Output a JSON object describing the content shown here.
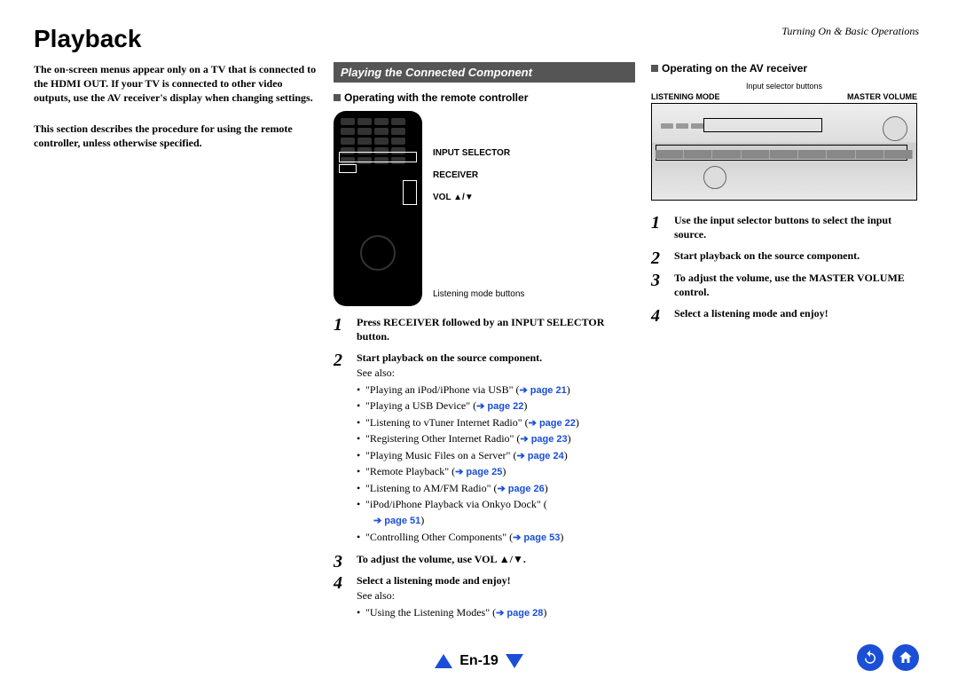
{
  "header": {
    "breadcrumb": "Turning On & Basic Operations"
  },
  "title": "Playback",
  "col1": {
    "note1": "The on-screen menus appear only on a TV that is connected to the HDMI OUT. If your TV is connected to other video outputs, use the AV receiver's display when changing settings.",
    "note2": "This section describes the procedure for using the remote controller, unless otherwise specified."
  },
  "col2": {
    "section": "Playing the Connected Component",
    "sub": "Operating with the remote controller",
    "callouts": {
      "c1": "INPUT SELECTOR",
      "c2": "RECEIVER",
      "c3": "VOL ▲/▼",
      "c4": "Listening mode buttons"
    },
    "steps": [
      {
        "head": "Press RECEIVER followed by an INPUT SELECTOR button."
      },
      {
        "head": "Start playback on the source component.",
        "sub": "See also:",
        "bullets": [
          {
            "t": "\"Playing an iPod/iPhone via USB\" (",
            "link": "page 21",
            "after": ")"
          },
          {
            "t": "\"Playing a USB Device\" (",
            "link": "page 22",
            "after": ")"
          },
          {
            "t": "\"Listening to vTuner Internet Radio\" (",
            "link": "page 22",
            "after": ")"
          },
          {
            "t": "\"Registering Other Internet Radio\" (",
            "link": "page 23",
            "after": ")"
          },
          {
            "t": "\"Playing Music Files on a Server\" (",
            "link": "page 24",
            "after": ")"
          },
          {
            "t": "\"Remote Playback\" (",
            "link": "page 25",
            "after": ")"
          },
          {
            "t": "\"Listening to AM/FM Radio\" (",
            "link": "page 26",
            "after": ")"
          },
          {
            "t": "\"iPod/iPhone Playback via Onkyo Dock\" (",
            "link": "page 51",
            "after": ")",
            "indent": true
          },
          {
            "t": "\"Controlling Other Components\" (",
            "link": "page 53",
            "after": ")"
          }
        ]
      },
      {
        "head": "To adjust the volume, use VOL ▲/▼."
      },
      {
        "head": "Select a listening mode and enjoy!",
        "sub": "See also:",
        "bullets": [
          {
            "t": "\"Using the Listening Modes\" (",
            "link": "page 28",
            "after": ")"
          }
        ]
      }
    ]
  },
  "col3": {
    "sub": "Operating on the AV receiver",
    "labels": {
      "top": "Input selector buttons",
      "left": "LISTENING MODE",
      "right": "MASTER VOLUME"
    },
    "steps": [
      {
        "head": "Use the input selector buttons to select the input source."
      },
      {
        "head": "Start playback on the source component."
      },
      {
        "head": "To adjust the volume, use the MASTER VOLUME control."
      },
      {
        "head": "Select a listening mode and enjoy!"
      }
    ]
  },
  "footer": {
    "page": "En-19"
  }
}
